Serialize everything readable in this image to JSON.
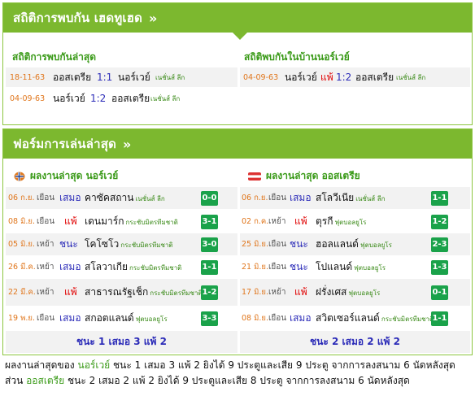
{
  "h2h": {
    "title": "สถิติการพบกัน เฮดทูเฮด",
    "chevron": "»",
    "recent_title": "สถิติการพบกันล่าสุด",
    "home_title": "สถิติพบกันในบ้านนอร์เวย์",
    "recent": [
      {
        "date": "18-11-63",
        "home": "ออสเตรีย",
        "score": "1:1",
        "away": "นอร์เวย์",
        "league": "เนชั่นส์ ลีก"
      },
      {
        "date": "04-09-63",
        "home": "นอร์เวย์",
        "score": "1:2",
        "away": "ออสเตรีย",
        "league": "เนชั่นส์ ลีก"
      }
    ],
    "home": [
      {
        "date": "04-09-63",
        "home": "นอร์เวย์",
        "result": "แพ้",
        "score": "1:2",
        "away": "ออสเตรีย",
        "league": "เนชั่นส์ ลีก"
      }
    ]
  },
  "form": {
    "title": "ฟอร์มการเล่นล่าสุด",
    "chevron": "»",
    "left": {
      "heading": "ผลงานล่าสุด นอร์เวย์",
      "icon": "norway-flag-icon",
      "rows": [
        {
          "date": "06 ก.ย.",
          "venue": "เยือน",
          "result": "เสมอ",
          "kind": "draw",
          "opp": "คาซัคสถาน",
          "league": "เนชั่นส์ ลีก",
          "score": "0-0"
        },
        {
          "date": "08 มิ.ย.",
          "venue": "เยือน",
          "result": "แพ้",
          "kind": "loss",
          "opp": "เดนมาร์ก",
          "league": "กระชับมิตรทีมชาติ",
          "score": "3-1"
        },
        {
          "date": "05 มิ.ย.",
          "venue": "เหย้า",
          "result": "ชนะ",
          "kind": "win",
          "opp": "โคโซโว",
          "league": "กระชับมิตรทีมชาติ",
          "score": "3-0"
        },
        {
          "date": "26 มี.ค.",
          "venue": "เหย้า",
          "result": "เสมอ",
          "kind": "draw",
          "opp": "สโลวาเกีย",
          "league": "กระชับมิตรทีมชาติ",
          "score": "1-1"
        },
        {
          "date": "22 มี.ค.",
          "venue": "เหย้า",
          "result": "แพ้",
          "kind": "loss",
          "opp": "สาธารณรัฐเช็ก",
          "league": "กระชับมิตรทีมชาติ",
          "score": "1-2"
        },
        {
          "date": "19 พ.ย.",
          "venue": "เยือน",
          "result": "เสมอ",
          "kind": "draw",
          "opp": "สกอตแลนด์",
          "league": "ฟุตบอลยูโร",
          "score": "3-3"
        }
      ],
      "summary": "ชนะ 1 เสมอ 3 แพ้ 2"
    },
    "right": {
      "heading": "ผลงานล่าสุด ออสเตรีย",
      "icon": "austria-flag-icon",
      "rows": [
        {
          "date": "06 ก.ย.",
          "venue": "เยือน",
          "result": "เสมอ",
          "kind": "draw",
          "opp": "สโลวีเนีย",
          "league": "เนชั่นส์ ลีก",
          "score": "1-1"
        },
        {
          "date": "02 ก.ค.",
          "venue": "เหย้า",
          "result": "แพ้",
          "kind": "loss",
          "opp": "ตุรกี",
          "league": "ฟุตบอลยูโร",
          "score": "1-2"
        },
        {
          "date": "25 มิ.ย.",
          "venue": "เยือน",
          "result": "ชนะ",
          "kind": "win",
          "opp": "ฮอลแลนด์",
          "league": "ฟุตบอลยูโร",
          "score": "2-3"
        },
        {
          "date": "21 มิ.ย.",
          "venue": "เยือน",
          "result": "ชนะ",
          "kind": "win",
          "opp": "โปแลนด์",
          "league": "ฟุตบอลยูโร",
          "score": "1-3"
        },
        {
          "date": "17 มิ.ย.",
          "venue": "เหย้า",
          "result": "แพ้",
          "kind": "loss",
          "opp": "ฝรั่งเศส",
          "league": "ฟุตบอลยูโร",
          "score": "0-1"
        },
        {
          "date": "08 มิ.ย.",
          "venue": "เยือน",
          "result": "เสมอ",
          "kind": "draw",
          "opp": "สวิตเซอร์แลนด์",
          "league": "กระชับมิตรทีมชาติ",
          "score": "1-1"
        }
      ],
      "summary": "ชนะ 2 เสมอ 2 แพ้ 2"
    }
  },
  "description": {
    "prefix": "ผลงานล่าสุดของ ",
    "team1": "นอร์เวย์",
    "middle": " ชนะ 1 เสมอ 3 แพ้ 2 ยิงได้ 9 ประตูและเสีย 9 ประตู จากการลงสนาม 6 นัดหลังสุด ส่วน ",
    "team2": "ออสเตรีย",
    "suffix": " ชนะ 2 เสมอ 2 แพ้ 2 ยิงได้ 9 ประตูและเสีย 8 ประตู จากการลงสนาม 6 นัดหลังสุด"
  },
  "colors": {
    "accent": "#7cb82f",
    "score_badge": "#1aa24a",
    "date": "#e0761c",
    "loss": "#e00000",
    "score": "#2b2bb8"
  }
}
